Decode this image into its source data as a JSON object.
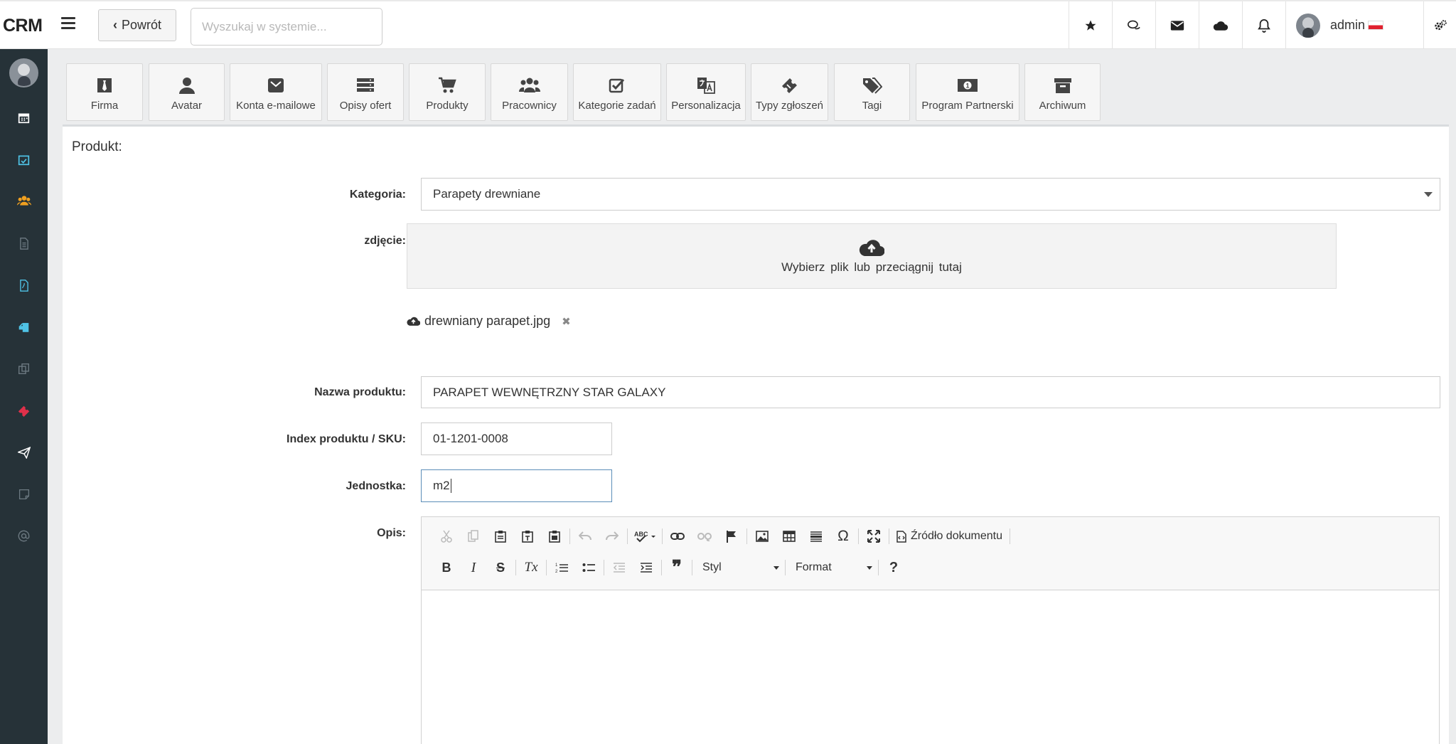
{
  "app": {
    "brand": "CRM"
  },
  "topbar": {
    "back_label": "Powrót",
    "search_placeholder": "Wyszukaj w systemie...",
    "user_name": "admin",
    "icons": [
      "star-icon",
      "chat-icon",
      "mail-icon",
      "cloud-icon",
      "bell-icon",
      "gears-icon"
    ]
  },
  "sidebar": {
    "items": [
      "calendar-icon",
      "calendar-check-icon",
      "users-icon",
      "document-icon",
      "pdf-icon",
      "clipboard-icon",
      "copy-icon",
      "ticket-icon",
      "paper-plane-icon",
      "note-icon",
      "at-icon"
    ]
  },
  "modules": [
    {
      "label": "Firma",
      "icon": "tie-icon"
    },
    {
      "label": "Avatar",
      "icon": "user-icon"
    },
    {
      "label": "Konta e-mailowe",
      "icon": "envelope-icon"
    },
    {
      "label": "Opisy ofert",
      "icon": "server-icon"
    },
    {
      "label": "Produkty",
      "icon": "cart-icon"
    },
    {
      "label": "Pracownicy",
      "icon": "users-icon"
    },
    {
      "label": "Kategorie zadań",
      "icon": "check-square-icon"
    },
    {
      "label": "Personalizacja",
      "icon": "translate-icon"
    },
    {
      "label": "Typy zgłoszeń",
      "icon": "ticket-icon"
    },
    {
      "label": "Tagi",
      "icon": "tags-icon"
    },
    {
      "label": "Program Partnerski",
      "icon": "money-icon"
    },
    {
      "label": "Archiwum",
      "icon": "archive-icon"
    }
  ],
  "form": {
    "title": "Produkt:",
    "category_label": "Kategoria:",
    "category_value": "Parapety drewniane",
    "photo_label": "zdjęcie:",
    "dropzone_text": "Wybierz plik  lub  przeciągnij tutaj",
    "file_name": "drewniany parapet.jpg",
    "file_remove": "✖",
    "name_label": "Nazwa produktu:",
    "name_value": "PARAPET WEWNĘTRZNY STAR GALAXY",
    "sku_label": "Index produktu / SKU:",
    "sku_value": "01-1201-0008",
    "unit_label": "Jednostka:",
    "unit_value": "m2",
    "desc_label": "Opis:"
  },
  "editor": {
    "source_label": "Źródło dokumentu",
    "style_label": "Styl",
    "format_label": "Format",
    "help_label": "?",
    "bold": "B",
    "italic": "I",
    "strike": "S",
    "clear": "Tx",
    "quote": "❞",
    "omega": "Ω"
  }
}
